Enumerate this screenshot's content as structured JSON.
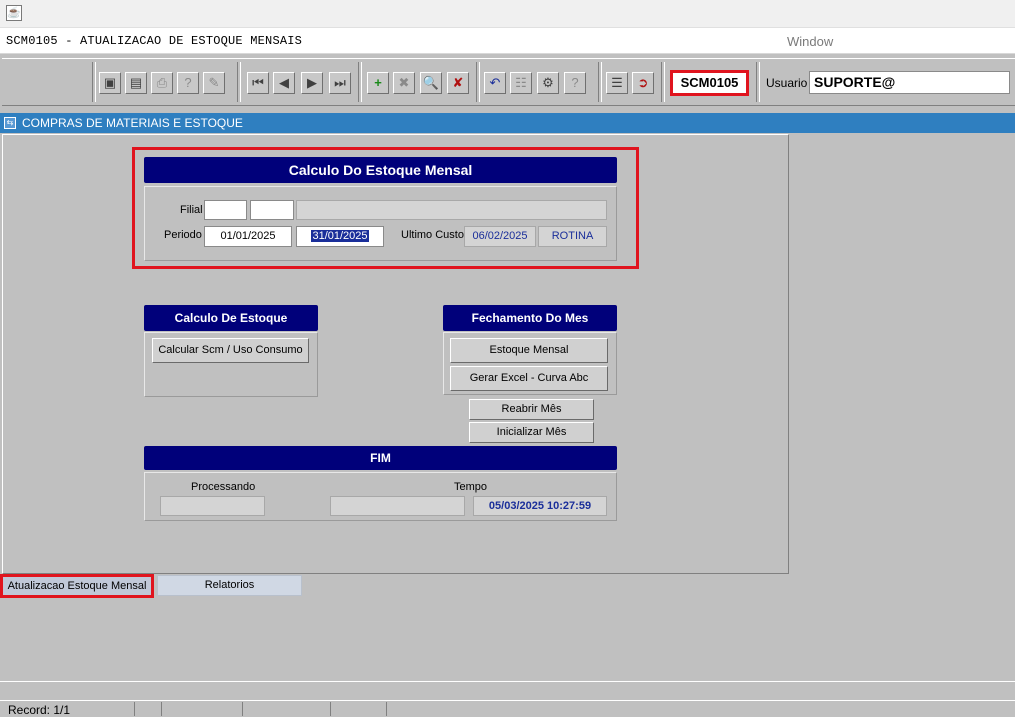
{
  "app": {
    "form_title": "SCM0105 - ATUALIZACAO DE ESTOQUE MENSAIS",
    "window_menu": "Window"
  },
  "toolbar": {
    "form_code": "SCM0105",
    "user_label": "Usuario",
    "user_value": "SUPORTE@"
  },
  "module": {
    "title": "COMPRAS DE MATERIAIS E ESTOQUE"
  },
  "calc": {
    "header": "Calculo Do Estoque Mensal",
    "filial_label": "Filial",
    "periodo_label": "Periodo",
    "periodo_start": "01/01/2025",
    "periodo_end": "31/01/2025",
    "ultimo_custo_label": "Ultimo Custo",
    "ultimo_custo_value": "06/02/2025",
    "ultimo_custo_user": "ROTINA"
  },
  "calc_estoque": {
    "header": "Calculo De Estoque",
    "button": "Calcular Scm / Uso Consumo"
  },
  "fechamento": {
    "header": "Fechamento Do Mes",
    "btn_estoque_mensal": "Estoque Mensal",
    "btn_gerar_excel": "Gerar Excel - Curva Abc",
    "btn_reabrir": "Reabrir Mês",
    "btn_inicializar": "Inicializar Mês"
  },
  "fim": {
    "header": "FIM",
    "processando_label": "Processando",
    "tempo_label": "Tempo",
    "tempo_value": "05/03/2025 10:27:59"
  },
  "tabs": {
    "active": "Atualizacao Estoque Mensal",
    "other": "Relatorios"
  },
  "status": {
    "record": "Record: 1/1"
  },
  "colors": {
    "header_bg": "#00007a",
    "module_band": "#2f7fc0",
    "highlight": "#e0141e",
    "value_blue": "#1a2e9a"
  }
}
